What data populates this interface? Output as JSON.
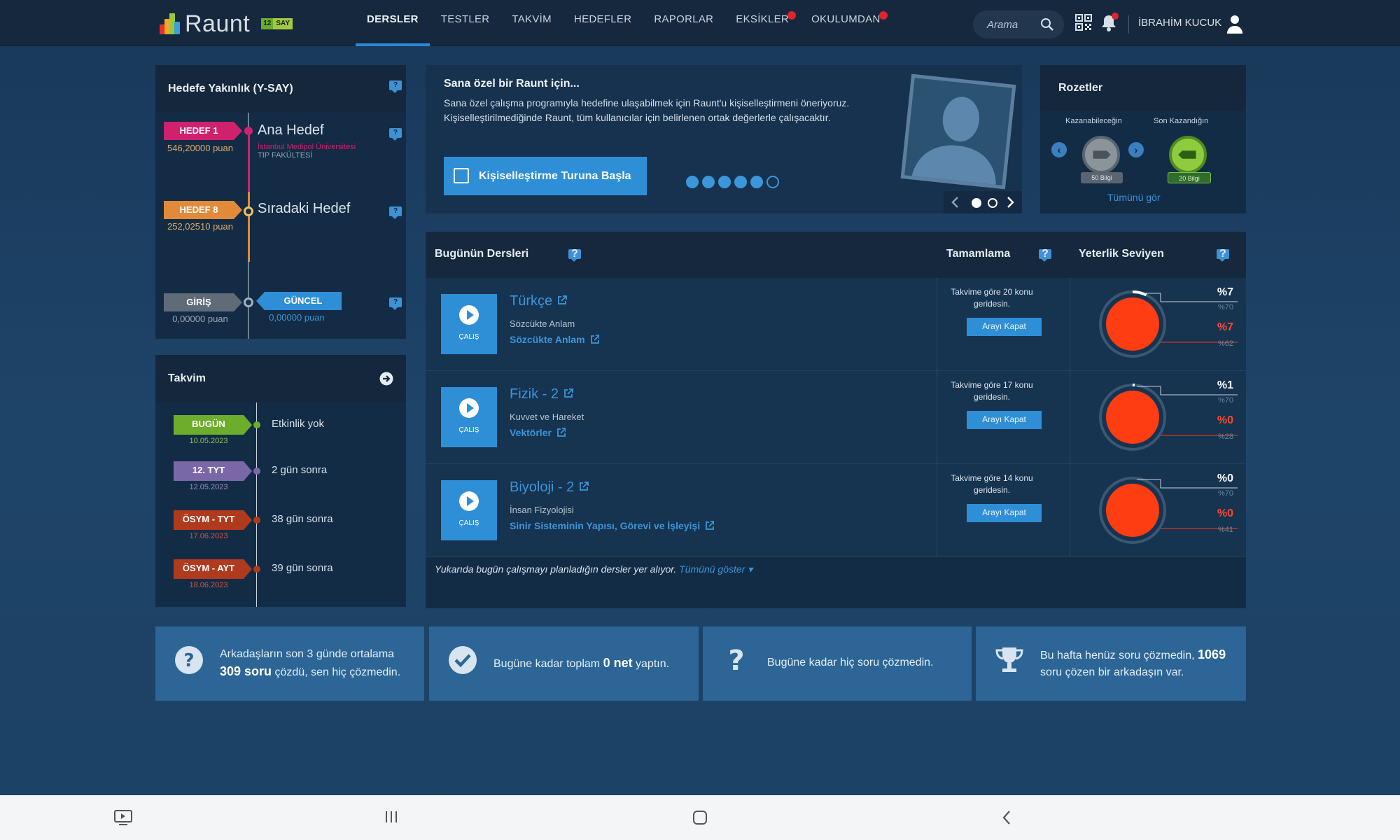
{
  "app": {
    "logo_text": "Raunt",
    "badge_num": "12",
    "badge_text": "SAY"
  },
  "nav": {
    "items": [
      {
        "label": "DERSLER",
        "active": true,
        "dot": false
      },
      {
        "label": "TESTLER",
        "active": false,
        "dot": false
      },
      {
        "label": "TAKVİM",
        "active": false,
        "dot": false
      },
      {
        "label": "HEDEFLER",
        "active": false,
        "dot": false
      },
      {
        "label": "RAPORLAR",
        "active": false,
        "dot": false
      },
      {
        "label": "EKSİKLER",
        "active": false,
        "dot": true
      },
      {
        "label": "OKULUMDAN",
        "active": false,
        "dot": true
      }
    ],
    "search_placeholder": "Arama",
    "user_name": "İBRAHİM KUCUK"
  },
  "goal": {
    "title": "Hedefe Yakınlık (Y-SAY)",
    "target1_tag": "HEDEF 1",
    "target1_points": "546,20000 puan",
    "target1_title": "Ana Hedef",
    "target1_school": "İstanbul Medipol Üniversitesi",
    "target1_faculty": "TIP FAKÜLTESİ",
    "target8_tag": "HEDEF 8",
    "target8_points": "252,02510 puan",
    "target8_title": "Sıradaki Hedef",
    "entry_tag": "GİRİŞ",
    "entry_points": "0,00000 puan",
    "current_tag": "GÜNCEL",
    "current_points": "0,00000 puan"
  },
  "calendar": {
    "title": "Takvim",
    "items": [
      {
        "tag": "BUGÜN",
        "date": "10.05.2023",
        "text": "Etkinlik yok",
        "num": "",
        "color": "#6cad2b"
      },
      {
        "tag": "12. TYT",
        "date": "12.05.2023",
        "text": "gün sonra",
        "num": "2",
        "color": "#7a67a8"
      },
      {
        "tag": "ÖSYM - TYT",
        "date": "17.06.2023",
        "text": "gün sonra",
        "num": "38",
        "color": "#b03a1d"
      },
      {
        "tag": "ÖSYM - AYT",
        "date": "18.06.2023",
        "text": "gün sonra",
        "num": "39",
        "color": "#b03a1d"
      }
    ]
  },
  "personalize": {
    "title": "Sana özel bir Raunt için...",
    "text": "Sana özel çalışma programıyla hedefine ulaşabilmek için Raunt'u kişiselleştirmeni öneriyoruz. Kişiselleştirilmediğinde Raunt, tüm kullanıcılar için belirlenen ortak değerlerle çalışacaktır.",
    "button": "Kişiselleştirme Turuna Başla",
    "steps_done": 5,
    "steps_total": 6
  },
  "badges": {
    "title": "Rozetler",
    "earnable_label": "Kazanabileceğin",
    "last_label": "Son Kazandığın",
    "earnable_pill": "50 Bilgi",
    "last_pill": "20 Bilgi",
    "see_all": "Tümünü gör"
  },
  "lessons": {
    "title": "Bugünün Dersleri",
    "completion_title": "Tamamlama",
    "level_title": "Yeterlik Seviyen",
    "play_label": "ÇALIŞ",
    "close_label": "Arayı Kapat",
    "rows": [
      {
        "name": "Türkçe",
        "sub": "Sözcükte Anlam",
        "topic": "Sözcükte Anlam",
        "behind": "Takvime göre 20 konu geridesin.",
        "top_val": "%7",
        "top_ref": "%70",
        "bot_val": "%7",
        "bot_ref": "%62",
        "progress": 0.07
      },
      {
        "name": "Fizik - 2",
        "sub": "Kuvvet ve Hareket",
        "topic": "Vektörler",
        "behind": "Takvime göre 17 konu geridesin.",
        "top_val": "%1",
        "top_ref": "%70",
        "bot_val": "%0",
        "bot_ref": "%28",
        "progress": 0.01
      },
      {
        "name": "Biyoloji - 2",
        "sub": "İnsan Fizyolojisi",
        "topic": "Sinir Sisteminin Yapısı, Görevi ve İşleyişi",
        "behind": "Takvime göre 14 konu geridesin.",
        "top_val": "%0",
        "top_ref": "%70",
        "bot_val": "%0",
        "bot_ref": "%41",
        "progress": 0.0
      }
    ],
    "footnote": "Yukarıda bugün çalışmayı planladığın dersler yer alıyor.",
    "show_all": "Tümünü göster"
  },
  "stats": {
    "s1_pre": "Arkadaşların son 3 günde ortalama",
    "s1_num": "309 soru",
    "s1_post": "çözdü, sen hiç çözmedin.",
    "s2_pre": "Bugüne kadar toplam",
    "s2_num": "0 net",
    "s2_post": "yaptın.",
    "s3": "Bugüne kadar hiç soru çözmedin.",
    "s4_pre": "Bu hafta henüz soru çözmedin,",
    "s4_num": "1069",
    "s4_post": "soru çözen bir arkadaşın var."
  },
  "colors": {
    "accent": "#2f8fd6",
    "gauge_fill": "#ff3d12",
    "target1": "#d0216d",
    "target8": "#e08a3a"
  }
}
